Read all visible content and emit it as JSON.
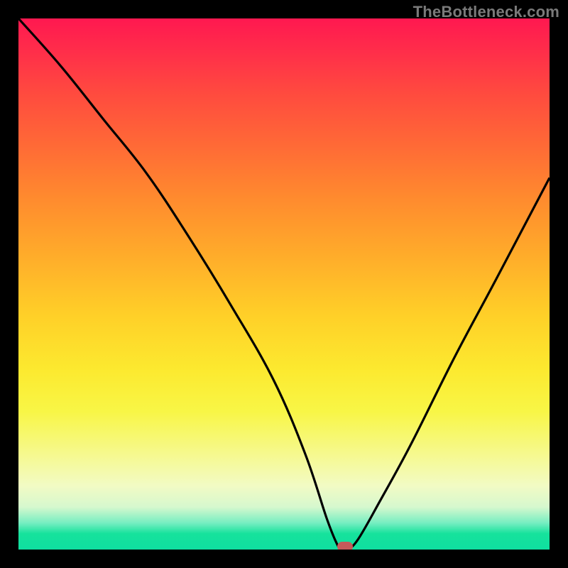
{
  "watermark": "TheBottleneck.com",
  "colors": {
    "curve": "#000000",
    "marker": "#c55a5a",
    "frame_bg": "#000000"
  },
  "chart_data": {
    "type": "line",
    "title": "",
    "xlabel": "",
    "ylabel": "",
    "xlim": [
      0,
      100
    ],
    "ylim": [
      0,
      100
    ],
    "grid": false,
    "legend": false,
    "series": [
      {
        "name": "bottleneck-curve",
        "x": [
          0,
          8,
          16,
          24,
          32,
          40,
          48,
          54,
          58,
          60,
          61,
          62,
          64,
          68,
          74,
          82,
          90,
          100
        ],
        "y": [
          100,
          91,
          81,
          71,
          59,
          46,
          32,
          18,
          6,
          1,
          0,
          0,
          2,
          9,
          20,
          36,
          51,
          70
        ],
        "_comment": "y = 0 is the bottom green strip (ideal / no bottleneck), y = 100 is top red"
      }
    ],
    "annotations": [
      {
        "name": "optimal-point-marker",
        "x": 61.5,
        "y": 0
      }
    ],
    "_note": "Axes are unlabeled in the source image; values are normalized 0–100 and estimated from the curve geometry."
  }
}
